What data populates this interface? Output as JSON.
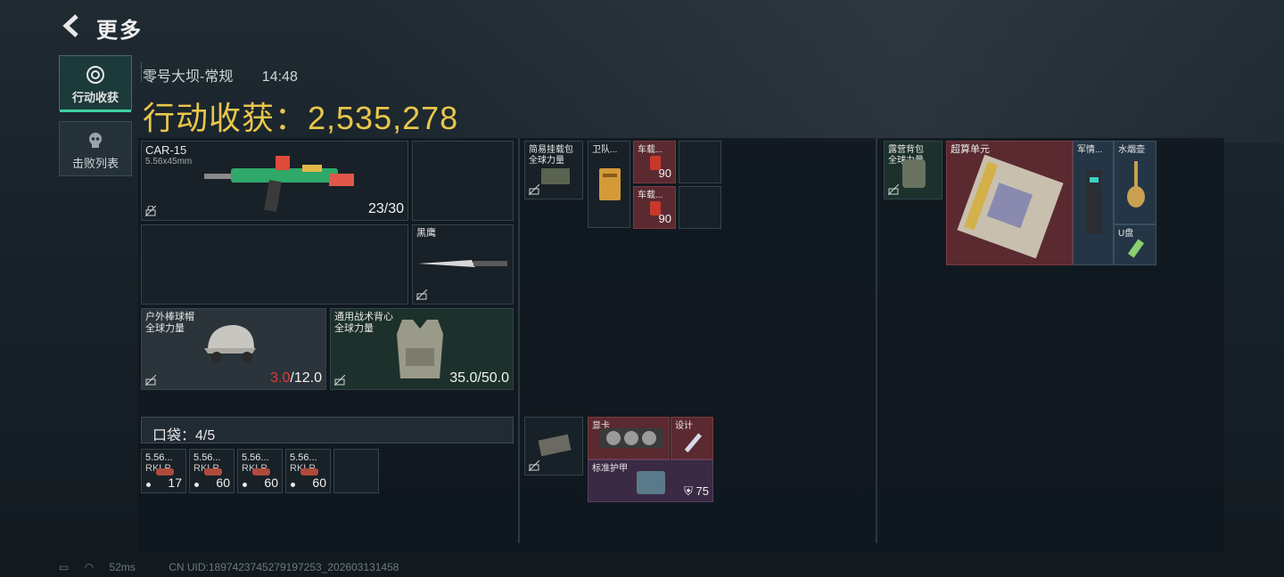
{
  "header": {
    "title": "更多"
  },
  "tabs": [
    {
      "label": "行动收获"
    },
    {
      "label": "击败列表"
    }
  ],
  "sub": {
    "map": "零号大坝-常规",
    "time": "14:48"
  },
  "harvest": {
    "label": "行动收获：",
    "value": "2,535,278"
  },
  "gear": {
    "weapon": {
      "name": "CAR-15",
      "ammo_type": "5.56x45mm",
      "ammo": "23/30"
    },
    "melee": {
      "name": "黑鹰"
    },
    "helmet": {
      "name": "户外棒球帽",
      "sub": "全球力量",
      "dur_cur": "3.0",
      "dur_max": "/12.0"
    },
    "armor": {
      "name": "通用战术背心",
      "sub": "全球力量",
      "dur": "35.0/50.0"
    }
  },
  "pocket": {
    "label": "口袋：4/5",
    "items": [
      {
        "name": "5.56...",
        "type": "RKLP",
        "count": "17"
      },
      {
        "name": "5.56...",
        "type": "RKLP",
        "count": "60"
      },
      {
        "name": "5.56...",
        "type": "RKLP",
        "count": "60"
      },
      {
        "name": "5.56...",
        "type": "RKLP",
        "count": "60"
      }
    ]
  },
  "rig": {
    "items": [
      {
        "name": "简易挂载包",
        "sub": "全球力量"
      },
      {
        "name": "卫队..."
      },
      {
        "name": "车载...",
        "count": "90"
      },
      {
        "name": "车载...",
        "count": "90"
      }
    ]
  },
  "backpack_mid": {
    "items": [
      {
        "name": "显卡"
      },
      {
        "name": "设计"
      },
      {
        "name": "标准护甲",
        "count": "75"
      }
    ]
  },
  "backpack": {
    "items": [
      {
        "name": "露营背包",
        "sub": "全球力量"
      },
      {
        "name": "超算单元"
      },
      {
        "name": "军情..."
      },
      {
        "name": "水烟壶"
      },
      {
        "name": "U盘"
      }
    ]
  },
  "status": {
    "ping": "52ms",
    "uid": "CN UID:1897423745279197253_202603131458"
  }
}
